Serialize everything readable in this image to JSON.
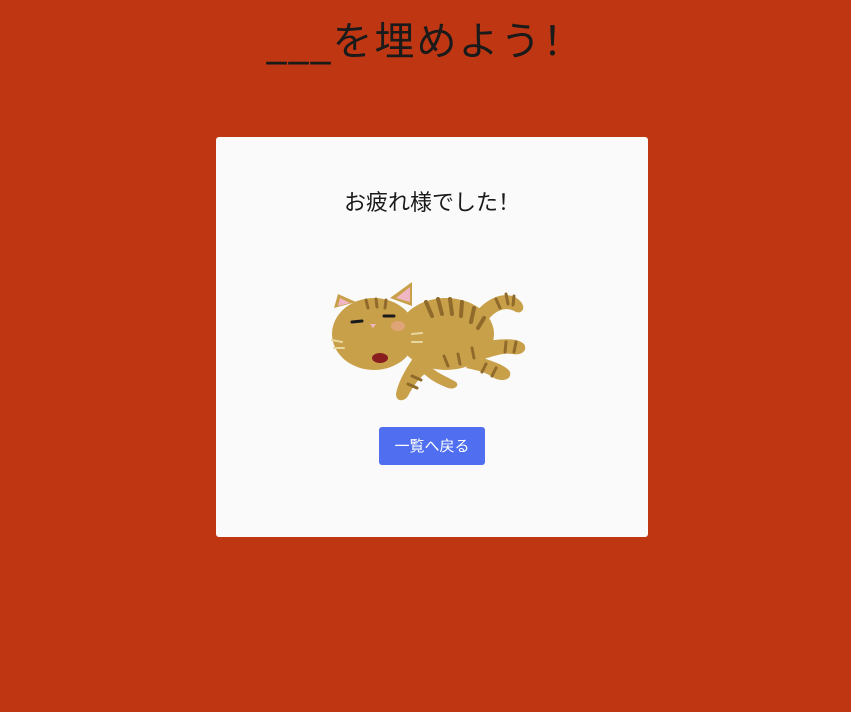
{
  "header": {
    "title": "___を埋めよう！"
  },
  "card": {
    "message": "お疲れ様でした！",
    "illustration": "tired-cat-illustration",
    "back_button_label": "一覧へ戻る"
  },
  "colors": {
    "background": "#be3712",
    "card": "#fafafa",
    "button": "#4f6ff0",
    "button_text": "#ffffff"
  }
}
